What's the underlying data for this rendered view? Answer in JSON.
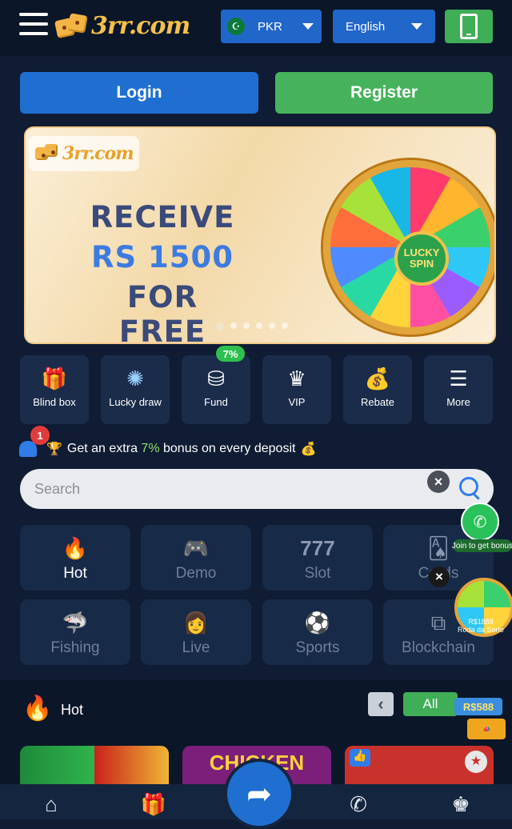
{
  "header": {
    "logo_text": "3rr.com",
    "currency": "PKR",
    "language": "English"
  },
  "auth": {
    "login_label": "Login",
    "register_label": "Register"
  },
  "banner": {
    "logo_text": "3rr.com",
    "line1": "RECEIVE",
    "line2": "RS 1500",
    "line3": "FOR FREE",
    "wheel_label_1": "LUCKY",
    "wheel_label_2": "SPIN",
    "slide_count": 6,
    "active_slide": 1
  },
  "quick_links": [
    {
      "label": "Blind box",
      "icon": "gift-box-icon"
    },
    {
      "label": "Lucky draw",
      "icon": "spin-wheel-icon"
    },
    {
      "label": "Fund",
      "icon": "fund-icon",
      "badge": "7%"
    },
    {
      "label": "VIP",
      "icon": "vip-crown-icon"
    },
    {
      "label": "Rebate",
      "icon": "money-bag-icon"
    },
    {
      "label": "More",
      "icon": "layers-icon"
    }
  ],
  "notice": {
    "badge_count": "1",
    "text_before": "Get an extra ",
    "highlight": "7%",
    "text_after": " bonus on every deposit"
  },
  "search": {
    "placeholder": "Search"
  },
  "categories": [
    {
      "label": "Hot",
      "icon": "fire-icon",
      "active": true
    },
    {
      "label": "Demo",
      "icon": "gamepad-icon"
    },
    {
      "label": "Slot",
      "icon": "slot-777-icon"
    },
    {
      "label": "Cards",
      "icon": "cards-icon"
    },
    {
      "label": "Fishing",
      "icon": "shark-icon"
    },
    {
      "label": "Live",
      "icon": "dealer-icon"
    },
    {
      "label": "Sports",
      "icon": "soccer-ball-icon"
    },
    {
      "label": "Blockchain",
      "icon": "blocks-icon"
    }
  ],
  "hot": {
    "title": "Hot",
    "all_label": "All",
    "game_2_title": "CHICKEN"
  },
  "floating": {
    "whatsapp_label": "Join to get bonus",
    "wheel_label_1": "R$1888",
    "wheel_label_2": "Roda da Sorte",
    "rs_badge": "R$588"
  },
  "colors": {
    "background": "#0f1c33",
    "primary": "#2166c9",
    "success": "#3fae57"
  }
}
